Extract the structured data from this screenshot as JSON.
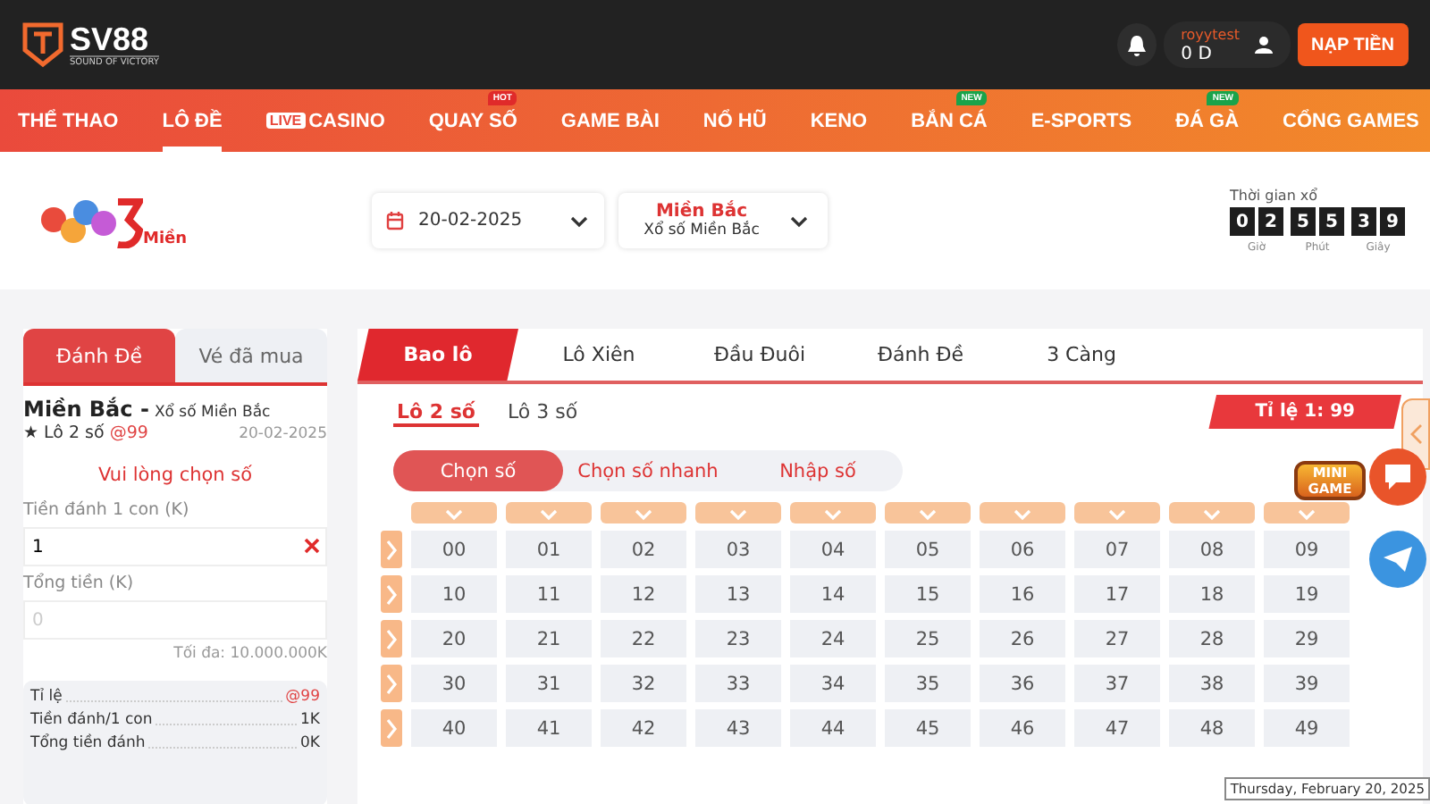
{
  "header": {
    "logo_text": "SV88",
    "logo_tagline": "SOUND OF VICTORY",
    "username": "royytest",
    "balance": "0 D",
    "deposit_button": "NẠP TIỀN"
  },
  "nav": [
    {
      "label": "THỂ THAO",
      "selected": false
    },
    {
      "label": "LÔ ĐỀ",
      "selected": true
    },
    {
      "label": "CASINO",
      "selected": false,
      "tag": "LIVE"
    },
    {
      "label": "QUAY SỐ",
      "selected": false,
      "badge": {
        "text": "HOT",
        "color": "#e02a2a"
      }
    },
    {
      "label": "GAME BÀI",
      "selected": false
    },
    {
      "label": "NỔ HŨ",
      "selected": false
    },
    {
      "label": "KENO",
      "selected": false
    },
    {
      "label": "BẮN CÁ",
      "selected": false,
      "badge": {
        "text": "NEW",
        "color": "#1aa34a"
      }
    },
    {
      "label": "E-SPORTS",
      "selected": false
    },
    {
      "label": "ĐÁ GÀ",
      "selected": false,
      "badge": {
        "text": "NEW",
        "color": "#1aa34a"
      }
    },
    {
      "label": "CỔNG GAMES",
      "selected": false
    }
  ],
  "lottery_bar": {
    "logo_text": "Miền",
    "date": "20-02-2025",
    "region": "Miền Bắc",
    "region_sub": "Xổ số Miền Bắc",
    "countdown_title": "Thời gian xổ",
    "countdown": [
      {
        "label": "Giờ",
        "digits": [
          "0",
          "2"
        ]
      },
      {
        "label": "Phút",
        "digits": [
          "5",
          "5"
        ]
      },
      {
        "label": "Giây",
        "digits": [
          "3",
          "9"
        ]
      }
    ]
  },
  "bet_panel": {
    "tabs": [
      {
        "label": "Đánh Đề",
        "selected": true
      },
      {
        "label": "Vé đã mua",
        "selected": false
      }
    ],
    "region": "Miền Bắc -",
    "region_sub": "Xổ số Miền Bắc",
    "bet_type": "★ Lô 2 số",
    "odds": "@99",
    "date": "20-02-2025",
    "prompt": "Vui lòng chọn số",
    "stake_label": "Tiền đánh 1 con (K)",
    "stake_value": "1",
    "total_label": "Tổng tiền (K)",
    "total_placeholder": "0",
    "max_note": "Tối đa: 10.000.000K",
    "summary": [
      {
        "label": "Tỉ lệ",
        "value": "@99",
        "kind": "odds"
      },
      {
        "label": "Tiền đánh/1 con",
        "value": "1K",
        "kind": "plain"
      },
      {
        "label": "Tổng tiền đánh",
        "value": "0K",
        "kind": "plain"
      }
    ]
  },
  "game": {
    "tabs": [
      {
        "label": "Bao lô",
        "selected": true
      },
      {
        "label": "Lô Xiên",
        "selected": false
      },
      {
        "label": "Đầu Đuôi",
        "selected": false
      },
      {
        "label": "Đánh Đề",
        "selected": false
      },
      {
        "label": "3 Càng",
        "selected": false
      }
    ],
    "sub_tabs": [
      {
        "label": "Lô 2 số",
        "selected": true
      },
      {
        "label": "Lô 3 số",
        "selected": false
      }
    ],
    "ratio": "Tỉ lệ 1: 99",
    "modes": [
      {
        "label": "Chọn số",
        "selected": true
      },
      {
        "label": "Chọn số nhanh",
        "selected": false
      },
      {
        "label": "Nhập số",
        "selected": false
      }
    ],
    "grid": [
      [
        "00",
        "01",
        "02",
        "03",
        "04",
        "05",
        "06",
        "07",
        "08",
        "09"
      ],
      [
        "10",
        "11",
        "12",
        "13",
        "14",
        "15",
        "16",
        "17",
        "18",
        "19"
      ],
      [
        "20",
        "21",
        "22",
        "23",
        "24",
        "25",
        "26",
        "27",
        "28",
        "29"
      ],
      [
        "30",
        "31",
        "32",
        "33",
        "34",
        "35",
        "36",
        "37",
        "38",
        "39"
      ],
      [
        "40",
        "41",
        "42",
        "43",
        "44",
        "45",
        "46",
        "47",
        "48",
        "49"
      ]
    ]
  },
  "floating": {
    "mini_game": "MINI GAME",
    "tooltip": "Thursday, February 20, 2025"
  }
}
